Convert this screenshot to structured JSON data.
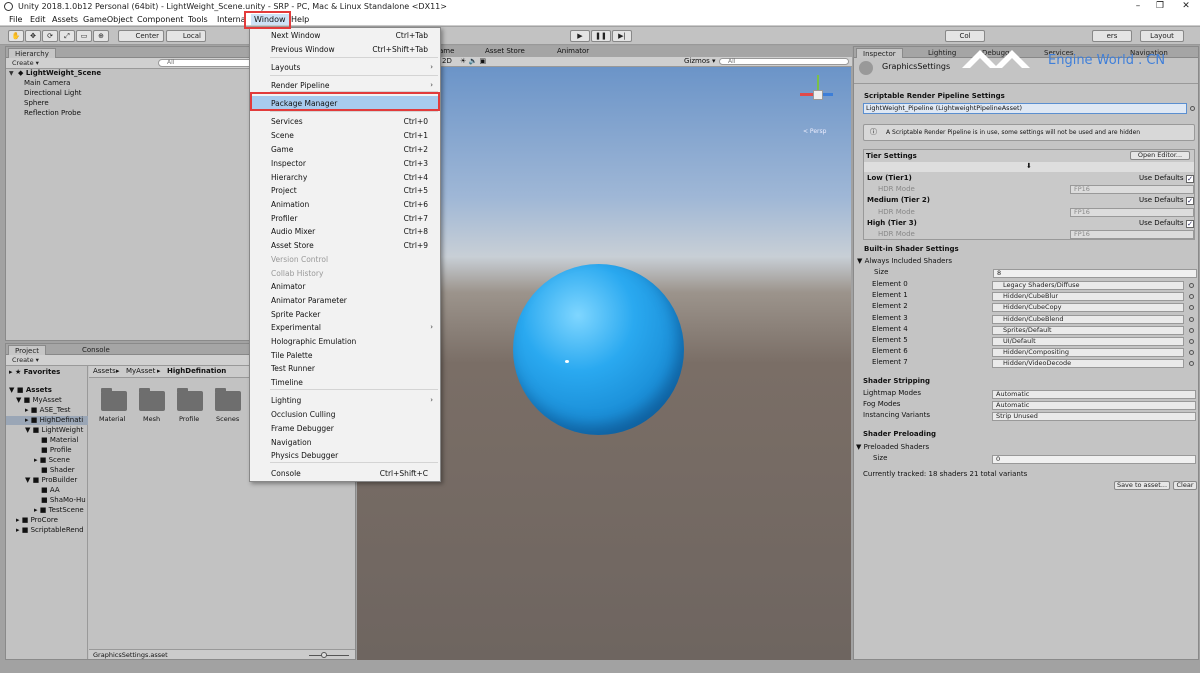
{
  "title_bar": {
    "title": "Unity 2018.1.0b12 Personal (64bit) - LightWeight_Scene.unity - SRP - PC, Mac & Linux Standalone <DX11>",
    "minimize": "–",
    "maximize": "❐",
    "close": "✕"
  },
  "menubar": {
    "file": "File",
    "edit": "Edit",
    "assets": "Assets",
    "gameobject": "GameObject",
    "component": "Component",
    "tools": "Tools",
    "internal": "Interna",
    "window": "Window",
    "help": "Help"
  },
  "toolbar": {
    "hand_icon": "hand-icon",
    "center": "Center",
    "local": "Local",
    "play": "▶",
    "pause": "❚❚",
    "step": "▶|",
    "collab": "Col",
    "layout": "Layout",
    "layers": "ers"
  },
  "hierarchy": {
    "tab": "Hierarchy",
    "create": "Create ▾",
    "search_placeholder": "All",
    "scene": "LightWeight_Scene",
    "items": [
      "Main Camera",
      "Directional Light",
      "Sphere",
      "Reflection Probe"
    ]
  },
  "project": {
    "tab_project": "Project",
    "tab_console": "Console",
    "create": "Create ▾",
    "favorites": "Favorites",
    "assets": "Assets",
    "tree": {
      "myasset": "MyAsset",
      "ase_test": "ASE_Test",
      "highdef": "HighDefinati",
      "lightweight": "LightWeight",
      "material": "Material",
      "profile": "Profile",
      "scene": "Scene",
      "shader": "Shader",
      "probuilder": "ProBuilder",
      "aa": "AA",
      "shamo": "ShaMo-Hu",
      "testscene": "TestScene",
      "procore": "ProCore",
      "scriptable": "ScriptableRend"
    },
    "breadcrumb": {
      "assets": "Assets",
      "sep1": "▸",
      "myasset": "MyAsset",
      "sep2": "▸",
      "highdef": "HighDefination"
    },
    "folders": [
      "Material",
      "Mesh",
      "Profile",
      "Scenes"
    ],
    "footer_file": "GraphicsSettings.asset"
  },
  "scene_view": {
    "tab_game": "ame",
    "tab_asset_store": "Asset Store",
    "tab_animator": "Animator",
    "mode_2d": "2D",
    "gizmos": "Gizmos ▾",
    "search_placeholder": "All",
    "persp": "< Persp"
  },
  "window_menu": {
    "items": [
      {
        "label": "Next Window",
        "shortcut": "Ctrl+Tab"
      },
      {
        "label": "Previous Window",
        "shortcut": "Ctrl+Shift+Tab"
      },
      {
        "label": "Layouts",
        "shortcut": ""
      },
      {
        "label": "Render Pipeline",
        "shortcut": ""
      },
      {
        "label": "Package Manager",
        "shortcut": ""
      },
      {
        "label": "Services",
        "shortcut": "Ctrl+0"
      },
      {
        "label": "Scene",
        "shortcut": "Ctrl+1"
      },
      {
        "label": "Game",
        "shortcut": "Ctrl+2"
      },
      {
        "label": "Inspector",
        "shortcut": "Ctrl+3"
      },
      {
        "label": "Hierarchy",
        "shortcut": "Ctrl+4"
      },
      {
        "label": "Project",
        "shortcut": "Ctrl+5"
      },
      {
        "label": "Animation",
        "shortcut": "Ctrl+6"
      },
      {
        "label": "Profiler",
        "shortcut": "Ctrl+7"
      },
      {
        "label": "Audio Mixer",
        "shortcut": "Ctrl+8"
      },
      {
        "label": "Asset Store",
        "shortcut": "Ctrl+9"
      },
      {
        "label": "Version Control",
        "shortcut": ""
      },
      {
        "label": "Collab History",
        "shortcut": ""
      },
      {
        "label": "Animator",
        "shortcut": ""
      },
      {
        "label": "Animator Parameter",
        "shortcut": ""
      },
      {
        "label": "Sprite Packer",
        "shortcut": ""
      },
      {
        "label": "Experimental",
        "shortcut": ""
      },
      {
        "label": "Holographic Emulation",
        "shortcut": ""
      },
      {
        "label": "Tile Palette",
        "shortcut": ""
      },
      {
        "label": "Test Runner",
        "shortcut": ""
      },
      {
        "label": "Timeline",
        "shortcut": ""
      },
      {
        "label": "Lighting",
        "shortcut": ""
      },
      {
        "label": "Occlusion Culling",
        "shortcut": ""
      },
      {
        "label": "Frame Debugger",
        "shortcut": ""
      },
      {
        "label": "Navigation",
        "shortcut": ""
      },
      {
        "label": "Physics Debugger",
        "shortcut": ""
      },
      {
        "label": "Console",
        "shortcut": "Ctrl+Shift+C"
      }
    ],
    "submenu_arrow": "›"
  },
  "inspector": {
    "tabs": {
      "inspector": "Inspector",
      "lighting": "Lighting",
      "debug": "Debugg",
      "services": "Services",
      "navigation": "Navigation"
    },
    "header": "GraphicsSettings",
    "srp_title": "Scriptable Render Pipeline Settings",
    "srp_asset": "LightWeight_Pipeline (LightweightPipelineAsset)",
    "warning": "A Scriptable Render Pipeline is in use, some settings will not be used and are hidden",
    "tier_settings": "Tier Settings",
    "open_editor": "Open Editor...",
    "tiers": [
      {
        "name": "Low (Tier1)",
        "use_defaults": "Use Defaults",
        "hdr": "HDR Mode",
        "hdr_value": "FP16"
      },
      {
        "name": "Medium (Tier 2)",
        "use_defaults": "Use Defaults",
        "hdr": "HDR Mode",
        "hdr_value": "FP16"
      },
      {
        "name": "High (Tier 3)",
        "use_defaults": "Use Defaults",
        "hdr": "HDR Mode",
        "hdr_value": "FP16"
      }
    ],
    "builtin_title": "Built-in Shader Settings",
    "always_included": "Always Included Shaders",
    "size_label": "Size",
    "size_value": "8",
    "elements": [
      {
        "label": "Element 0",
        "value": "Legacy Shaders/Diffuse"
      },
      {
        "label": "Element 1",
        "value": "Hidden/CubeBlur"
      },
      {
        "label": "Element 2",
        "value": "Hidden/CubeCopy"
      },
      {
        "label": "Element 3",
        "value": "Hidden/CubeBlend"
      },
      {
        "label": "Element 4",
        "value": "Sprites/Default"
      },
      {
        "label": "Element 5",
        "value": "UI/Default"
      },
      {
        "label": "Element 6",
        "value": "Hidden/Compositing"
      },
      {
        "label": "Element 7",
        "value": "Hidden/VideoDecode"
      }
    ],
    "stripping_title": "Shader Stripping",
    "lightmap_modes": "Lightmap Modes",
    "lightmap_value": "Automatic",
    "fog_modes": "Fog Modes",
    "fog_value": "Automatic",
    "instancing": "Instancing Variants",
    "instancing_value": "Strip Unused",
    "preloading_title": "Shader Preloading",
    "preloaded": "Preloaded Shaders",
    "pre_size_label": "Size",
    "pre_size_value": "0",
    "tracked": "Currently tracked: 18 shaders 21 total variants",
    "save_to_asset": "Save to asset...",
    "clear": "Clear"
  },
  "watermark": {
    "text": "Engine World . CN"
  }
}
